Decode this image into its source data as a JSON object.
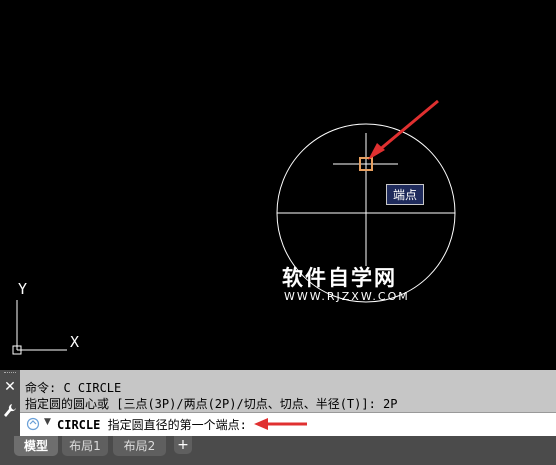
{
  "canvas": {
    "snap_tooltip": "端点",
    "axis_labels": {
      "y": "Y",
      "x": "X"
    },
    "watermark": {
      "title": "软件自学网",
      "subtitle": "WWW.RJZXW.COM"
    },
    "colors": {
      "background": "#000000",
      "geometry": "#ffffff",
      "snap_marker": "#e8a060",
      "annotation_arrow": "#e03030",
      "tooltip_bg": "#1f2b5c"
    }
  },
  "command_panel": {
    "history": [
      "命令: C CIRCLE",
      "指定圆的圆心或 [三点(3P)/两点(2P)/切点、切点、半径(T)]: 2P"
    ],
    "input": {
      "command": "CIRCLE",
      "prompt": "指定圆直径的第一个端点:"
    },
    "icons": {
      "close": "close-icon",
      "settings": "wrench-icon",
      "command": "command-icon"
    }
  },
  "layout_tabs": {
    "tabs": [
      "模型",
      "布局1",
      "布局2"
    ],
    "active": "模型",
    "add_label": "+"
  }
}
